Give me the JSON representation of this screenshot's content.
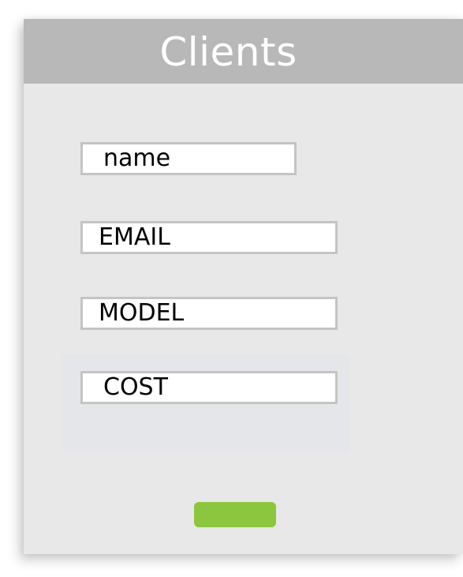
{
  "header": {
    "title": "Clients"
  },
  "form": {
    "fields": [
      {
        "label": "name"
      },
      {
        "label": "EMAIL"
      },
      {
        "label": "MODEL"
      },
      {
        "label": "COST"
      }
    ],
    "submit_label": ""
  },
  "colors": {
    "header_bg": "#b8b8b8",
    "card_bg": "#e8e8e8",
    "submit_bg": "#8cc63f"
  }
}
